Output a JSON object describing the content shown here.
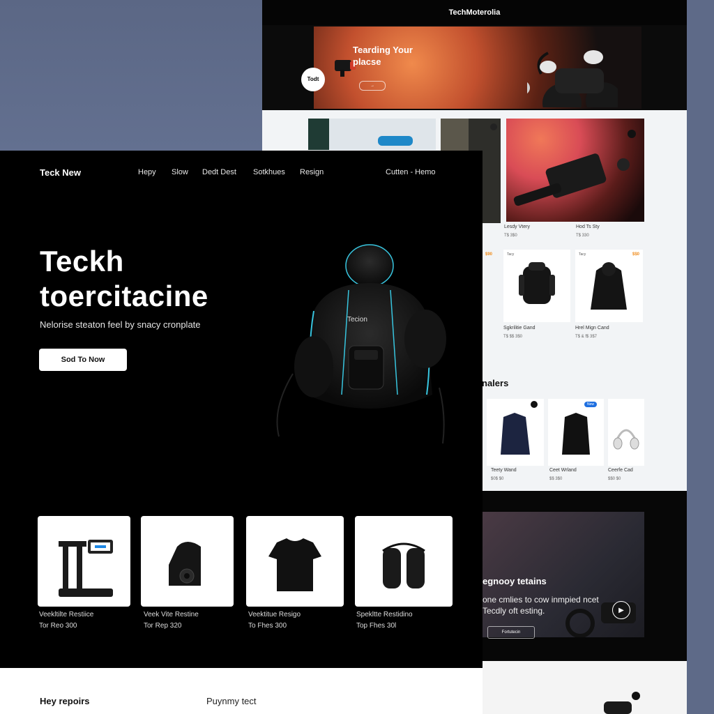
{
  "back_page": {
    "brand": "TechMoterolia",
    "hero": {
      "title": "Tearding Your placse",
      "badge": "Todt"
    },
    "row1_labels": [
      {
        "name": "Lesdy Vtery",
        "price": "T$ 3$0"
      },
      {
        "name": "Hod Ts Sty",
        "price": "T$ 330"
      }
    ],
    "row2_cards": [
      {
        "name": "Sgkrilitie Gand",
        "price": "T$ $$ 3$0",
        "tag": "Tacy",
        "price_tag": "$90"
      },
      {
        "name": "Hrel Mign Cand",
        "price": "T$ & f$ 3$7",
        "tag": "Tacy",
        "price_tag": "$$0"
      }
    ],
    "dealers_title": "nalers",
    "row3_cards": [
      {
        "name": "Teety Wand",
        "price": "$0$ $0"
      },
      {
        "name": "Ceet Wrland",
        "price": "$$ 3$0"
      },
      {
        "name": "Ceerfe Cad",
        "price": "$$0 $0"
      }
    ],
    "row3_badge": "New",
    "promo": {
      "title": "egnooy tetains",
      "text": "one cmlies to cow inmpied ncet Tecdly oft esting.",
      "button": "Fortutecin"
    }
  },
  "front_page": {
    "nav": {
      "brand": "Teck New",
      "links": [
        "Hepy",
        "Slow",
        "Dedt Dest",
        "Sotkhues",
        "Resign"
      ],
      "right": "Cutten - Hemo"
    },
    "hero": {
      "title_line1": "Teckh",
      "title_line2": "toercitacine",
      "subtitle": "Nelorise steaton feel by snacy cronplate",
      "button": "Sod To Now",
      "product_label": "Tecion"
    },
    "products": [
      {
        "name": "Veekltilte Restiice",
        "price": "Tor Reo 300"
      },
      {
        "name": "Veek Vite Restine",
        "price": "Tor Rep 320"
      },
      {
        "name": "Veektitue Resigo",
        "price": "To Fhes 300"
      },
      {
        "name": "Spekltte Restidino",
        "price": "Top Fhes 30l"
      }
    ],
    "footer": {
      "left": "Hey repoirs",
      "middle": "Puynmy tect"
    }
  },
  "colors": {
    "page_background": "#5d6a85",
    "hero_background": "#000000",
    "accent_cyan": "#38c6e0",
    "price_orange": "#f08c1c"
  }
}
